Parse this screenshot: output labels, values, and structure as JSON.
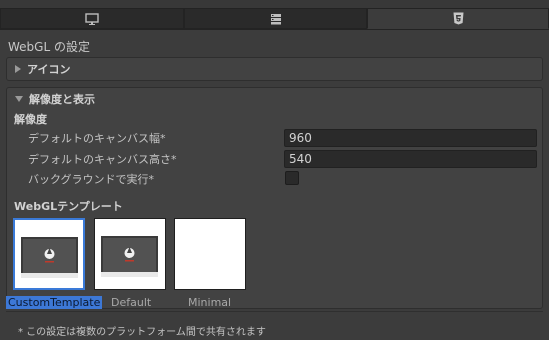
{
  "tabs": [
    {
      "icon": "monitor-icon",
      "active": false
    },
    {
      "icon": "server-icon",
      "active": false
    },
    {
      "icon": "html5-icon",
      "active": true
    }
  ],
  "page_title": "WebGL の設定",
  "sections": {
    "icon": {
      "label": "アイコン",
      "expanded": false
    },
    "resolution": {
      "label": "解像度と表示",
      "expanded": true
    }
  },
  "resolution": {
    "subheader": "解像度",
    "canvas_width_label": "デフォルトのキャンバス幅*",
    "canvas_width_value": "960",
    "canvas_height_label": "デフォルトのキャンバス高さ*",
    "canvas_height_value": "540",
    "run_in_background_label": "バックグラウンドで実行*",
    "run_in_background_checked": false
  },
  "templates": {
    "header": "WebGLテンプレート",
    "items": [
      {
        "name": "CustomTemplate",
        "has_preview": true,
        "selected": true
      },
      {
        "name": "Default",
        "has_preview": true,
        "selected": false
      },
      {
        "name": "Minimal",
        "has_preview": false,
        "selected": false
      }
    ]
  },
  "footer_note": "* この設定は複数のプラットフォーム間で共有されます",
  "colors": {
    "selection": "#3d78d6",
    "panel": "#3c3c3c",
    "field": "#2a2a2a"
  }
}
